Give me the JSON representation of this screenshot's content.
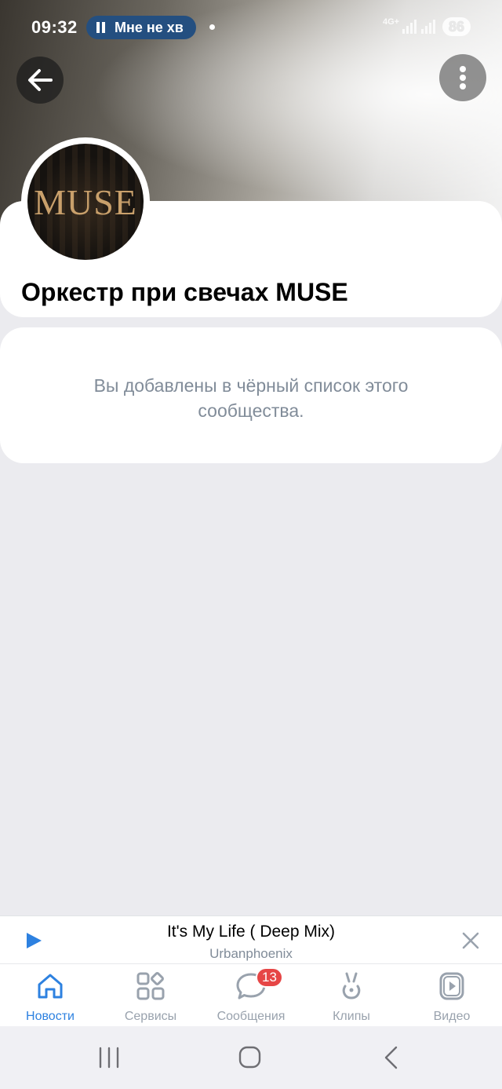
{
  "status_bar": {
    "time": "09:32",
    "media_text": "Мне не хв",
    "network": "4G+",
    "battery": "86"
  },
  "group": {
    "avatar_text": "MUSE",
    "title": "Оркестр при свечах MUSE"
  },
  "message": {
    "text": "Вы добавлены в чёрный список этого сообщества."
  },
  "player": {
    "title": "It's My Life ( Deep Mix)",
    "artist": "Urbanphoenix"
  },
  "tabs": [
    {
      "label": "Новости",
      "icon": "home-icon",
      "active": true
    },
    {
      "label": "Сервисы",
      "icon": "services-icon"
    },
    {
      "label": "Сообщения",
      "icon": "messages-icon",
      "badge": "13"
    },
    {
      "label": "Клипы",
      "icon": "clips-icon"
    },
    {
      "label": "Видео",
      "icon": "video-icon"
    }
  ],
  "colors": {
    "accent": "#2d81e0",
    "badge": "#e64646",
    "secondary_text": "#818c99",
    "background": "#ebebef"
  }
}
